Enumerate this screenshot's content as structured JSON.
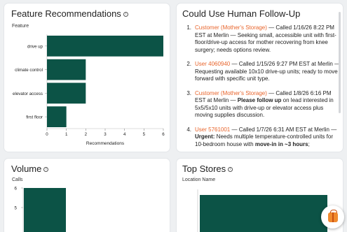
{
  "feature_card": {
    "title": "Feature Recommendations",
    "info_icon": "info-icon",
    "axis_label": "Feature"
  },
  "chart_data": [
    {
      "type": "bar",
      "orientation": "horizontal",
      "categories": [
        "drive up",
        "climate control",
        "elevator access",
        "first floor"
      ],
      "values": [
        6,
        2,
        2,
        1
      ],
      "title": "Feature Recommendations",
      "ylabel": "Feature",
      "xlabel": "Recommendations",
      "xlim": [
        0,
        6
      ],
      "xticks": [
        0,
        1,
        2,
        3,
        4,
        5,
        6
      ],
      "color": "#0c5346"
    },
    {
      "type": "bar",
      "title": "Volume",
      "ylabel": "Calls",
      "yticks": [
        5,
        6
      ],
      "ylim": [
        4.4,
        6
      ],
      "visible_values": [
        6
      ],
      "color": "#0c5346"
    },
    {
      "type": "bar",
      "title": "Top Stores",
      "ylabel": "Location Name",
      "color": "#0c5346"
    }
  ],
  "followup_card": {
    "title": "Could Use Human Follow-Up",
    "items": [
      {
        "number": "1.",
        "link": "Customer (Mother's Storage)",
        "text": " — Called 1/16/26 8:22 PM EST at Merlin — Seeking small, accessible unit with first-floor/drive-up access for mother recovering from knee surgery; needs options review."
      },
      {
        "number": "2.",
        "link": "User 4060940",
        "text": " — Called 1/15/26 9:27 PM EST at Merlin — Requesting available 10x10 drive-up units; ready to move forward with specific unit type."
      },
      {
        "number": "3.",
        "link": "Customer (Mother's Storage)",
        "text_before": " — Called 1/8/26 6:16 PM EST at Merlin — ",
        "bold": "Please follow up",
        "text_after": " on lead interested in 5x5/5x10 units with drive-up or elevator access plus moving supplies discussion."
      },
      {
        "number": "4.",
        "link": "User 5761001",
        "text_before": " — Called 1/7/26 6:31 AM EST at Merlin — ",
        "bold": "Urgent:",
        "text_middle": " Needs multiple temperature-controlled units for 10-bedroom house with ",
        "bold2": "move-in in ~3 hours",
        "text_after": ";"
      }
    ]
  },
  "volume_card": {
    "title": "Volume",
    "info_icon": "info-icon",
    "axis_label": "Calls"
  },
  "stores_card": {
    "title": "Top Stores",
    "info_icon": "info-icon",
    "axis_label": "Location Name"
  },
  "fab": {
    "icon": "gift-icon"
  }
}
